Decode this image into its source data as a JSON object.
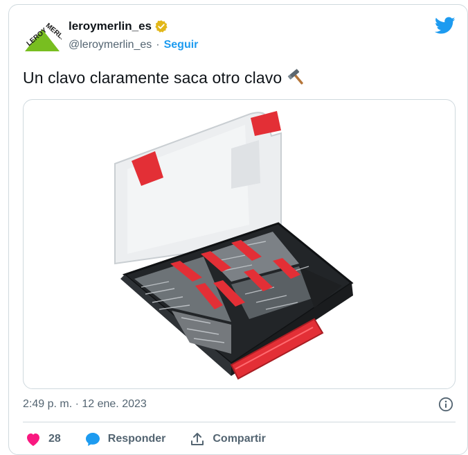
{
  "tweet": {
    "display_name": "leroymerlin_es",
    "handle": "@leroymerlin_es",
    "separator": "·",
    "follow_label": "Seguir",
    "text": "Un clavo claramente saca otro clavo",
    "emoji_icon": "hammer-icon",
    "timestamp": "2:49 p. m. · 12 ene. 2023"
  },
  "avatar": {
    "logo_text_top": "LEROY",
    "logo_text_bottom": "MERLIN",
    "brand_color": "#78be20"
  },
  "actions": {
    "like_count": "28",
    "reply_label": "Responder",
    "share_label": "Compartir"
  },
  "colors": {
    "accent": "#1d9bf0",
    "like": "#f91880",
    "verified": "#e2b719",
    "muted": "#536471"
  },
  "media": {
    "alt": "Caja organizadora de clavos con tapa transparente y separadores rojos"
  }
}
